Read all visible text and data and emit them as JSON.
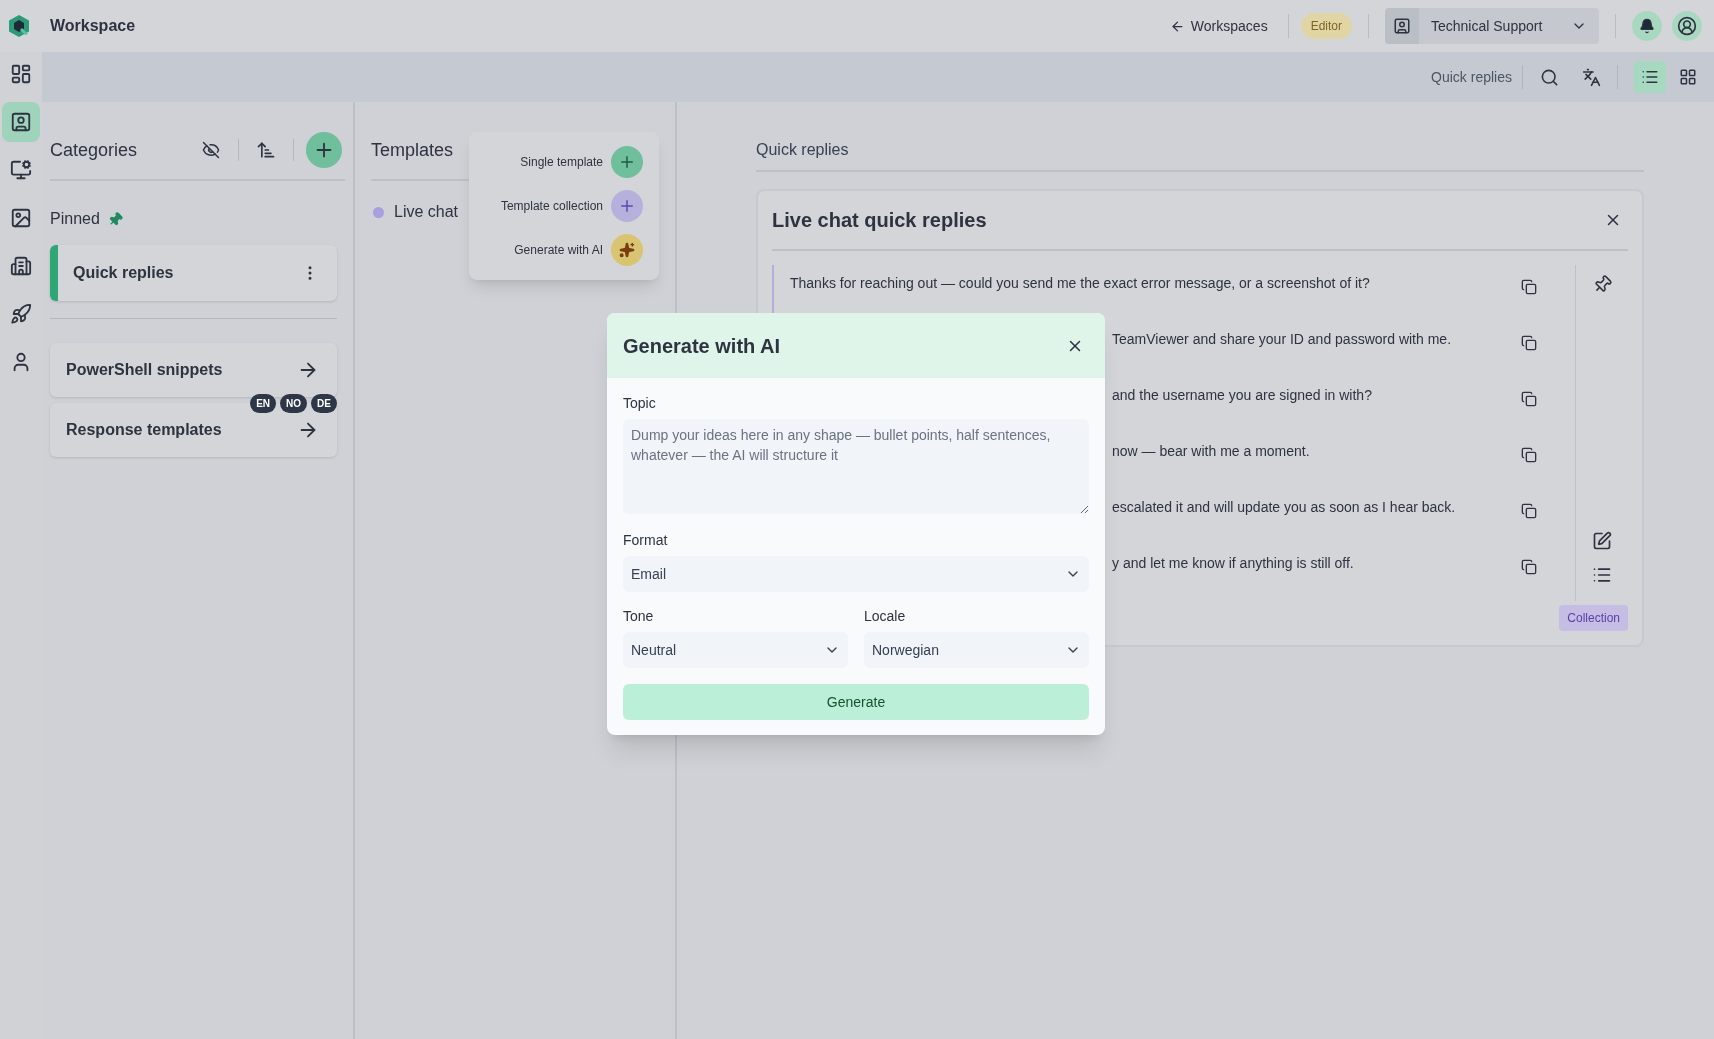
{
  "app": {
    "title": "Workspace"
  },
  "header": {
    "back_link": "Workspaces",
    "role_badge": "Editor",
    "workspace_select": "Technical Support"
  },
  "rail": [
    {
      "selected": false
    },
    {
      "selected": true
    },
    {
      "selected": false
    },
    {
      "selected": false
    },
    {
      "selected": false
    },
    {
      "selected": false
    },
    {
      "selected": false
    }
  ],
  "toolbar": {
    "label": "Quick replies",
    "views": [
      {
        "kind": "list",
        "selected": true
      },
      {
        "kind": "grid",
        "selected": false
      }
    ]
  },
  "categories": {
    "title": "Categories",
    "pinned_label": "Pinned",
    "pinned": [
      {
        "name": "Quick replies",
        "selected": true
      }
    ],
    "items": [
      {
        "name": "PowerShell snippets"
      },
      {
        "name": "Response templates",
        "badges": [
          "EN",
          "NO",
          "DE"
        ]
      }
    ]
  },
  "templates": {
    "title": "Templates",
    "items": [
      {
        "name": "Live chat",
        "color": "#a89ee0"
      }
    ]
  },
  "add_menu": [
    {
      "label": "Single template",
      "kind": "single"
    },
    {
      "label": "Template collection",
      "kind": "collection"
    },
    {
      "label": "Generate with AI",
      "kind": "ai"
    }
  ],
  "detail": {
    "breadcrumb": "Quick replies",
    "title": "Live chat quick replies",
    "tag": "Collection",
    "lines": [
      {
        "text": "Thanks for reaching out — could you send me the exact error message, or a screenshot of it?",
        "highlighted": true,
        "covered": false
      },
      {
        "text": "TeamViewer and share your ID and password with me.",
        "highlighted": false,
        "covered": true
      },
      {
        "text": "and the username you are signed in with?",
        "highlighted": false,
        "covered": true
      },
      {
        "text": "now — bear with me a moment.",
        "highlighted": false,
        "covered": true
      },
      {
        "text": "escalated it and will update you as soon as I hear back.",
        "highlighted": false,
        "covered": true
      },
      {
        "text": "y and let me know if anything is still off.",
        "highlighted": false,
        "covered": true
      }
    ]
  },
  "dialog": {
    "title": "Generate with AI",
    "topic_label": "Topic",
    "topic_placeholder": "Dump your ideas here in any shape — bullet points, half sentences, whatever — the AI will structure it",
    "format_label": "Format",
    "format_value": "Email",
    "tone_label": "Tone",
    "tone_value": "Neutral",
    "locale_label": "Locale",
    "locale_value": "Norwegian",
    "submit": "Generate"
  }
}
